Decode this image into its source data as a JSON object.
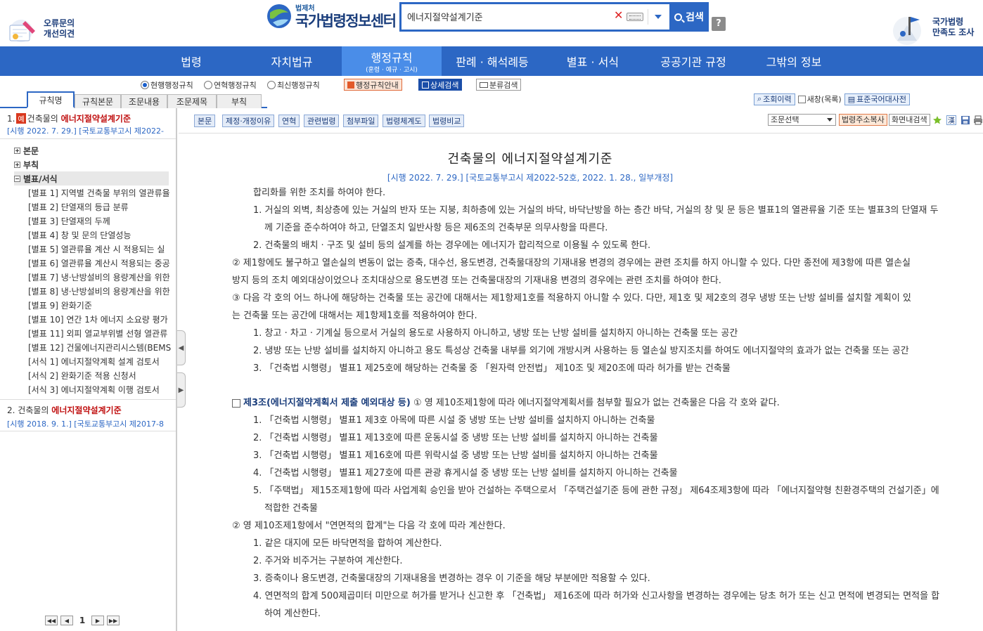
{
  "header": {
    "feedback_line1": "오류문의",
    "feedback_line2": "개선의견",
    "logo_sub": "법제처",
    "logo_main": "국가법령정보센터",
    "search_value": "에너지절약설계기준",
    "search_button": "검색",
    "help_label": "?",
    "survey_line1": "국가법령",
    "survey_line2": "만족도 조사"
  },
  "nav": {
    "items": [
      {
        "label": "법령",
        "sub": ""
      },
      {
        "label": "자치법규",
        "sub": ""
      },
      {
        "label": "행정규칙",
        "sub": "(훈령 · 예규 · 고시)"
      },
      {
        "label": "판례 · 해석례등",
        "sub": ""
      },
      {
        "label": "별표 · 서식",
        "sub": ""
      },
      {
        "label": "공공기관 규정",
        "sub": ""
      },
      {
        "label": "그밖의 정보",
        "sub": ""
      }
    ],
    "active_index": 2
  },
  "options": {
    "radios": [
      "현행행정규칙",
      "연혁행정규칙",
      "최신행정규칙"
    ],
    "selected_radio": 0,
    "btn_guide": "행정규칙안내",
    "btn_detail": "상세검색",
    "btn_class": "분류검색"
  },
  "left_tabs": [
    "규칙명",
    "규칙본문",
    "조문내용",
    "조문제목",
    "부칙"
  ],
  "right_tools": {
    "history": "조회이력",
    "newwin": "새창(목록)",
    "dictionary": "표준국어대사전"
  },
  "results": [
    {
      "index": "1.",
      "badge": "예",
      "prefix": "건축물의",
      "highlight": "에너지절약설계기준",
      "sub": "[시행 2022. 7. 29.] [국토교통부고시 제2022-"
    },
    {
      "index": "2.",
      "prefix": "건축물의",
      "highlight": "에너지절약설계기준",
      "sub": "[시행 2018. 9. 1.] [국토교통부고시 제2017-8"
    }
  ],
  "tree": {
    "nodes": [
      "본문",
      "부칙",
      "별표/서식"
    ],
    "leaves": [
      "[별표 1] 지역별 건축물 부위의 열관류율",
      "[별표 2] 단열재의 등급 분류",
      "[별표 3] 단열재의 두께",
      "[별표 4] 창 및 문의 단열성능",
      "[별표 5] 열관류율 계산 시 적용되는 실",
      "[별표 6] 열관류율 계산시 적용되는 중공",
      "[별표 7] 냉·난방설비의 용량계산을 위한",
      "[별표 8] 냉·난방설비의 용량계산을 위한",
      "[별표 9] 완화기준",
      "[별표 10] 연간 1차 에너지 소요량 평가",
      "[별표 11] 외피 열교부위별 선형 열관류",
      "[별표 12] 건물에너지관리시스템(BEMS",
      "[서식 1] 에너지절약계획 설계 검토서",
      "[서식 2] 완화기준 적용 신청서",
      "[서식 3] 에너지절약계획 이행 검토서"
    ]
  },
  "pager": {
    "current": "1"
  },
  "toolbar": {
    "buttons": [
      "본문",
      "제정·개정이유",
      "연혁",
      "관련법령",
      "첨부파일",
      "법령체계도",
      "법령비교"
    ],
    "select_article": "조문선택",
    "copy_address": "법령주소복사",
    "find_in_page": "화면내검색"
  },
  "document": {
    "title": "건축물의 에너지절약설계기준",
    "subtitle": "[시행 2022. 7. 29.] [국토교통부고시 제2022-52호, 2022. 1. 28., 일부개정]",
    "lines": [
      "합리화를 위한 조치를 하여야 한다.",
      "1. 거실의 외벽, 최상층에 있는 거실의 반자 또는 지붕, 최하층에 있는 거실의 바닥, 바닥난방을 하는 층간 바닥, 거실의 창 및 문 등은 별표1의 열관류율 기준 또는 별표3의 단열재 두",
      "께 기준을 준수하여야 하고, 단열조치 일반사항 등은 제6조의 건축부문 의무사항을 따른다.",
      "2. 건축물의 배치 · 구조 및 설비 등의 설계를 하는 경우에는 에너지가 합리적으로 이용될 수 있도록 한다.",
      "② 제1항에도 불구하고 열손실의 변동이 없는 증축, 대수선, 용도변경, 건축물대장의 기재내용 변경의 경우에는 관련 조치를 하지 아니할 수 있다. 다만 종전에 제3항에 따른 열손실",
      "방지 등의 조치 예외대상이었으나 조치대상으로 용도변경 또는 건축물대장의 기재내용 변경의 경우에는 관련 조치를 하여야 한다.",
      "③ 다음 각 호의 어느 하나에 해당하는 건축물 또는 공간에 대해서는 제1항제1호를 적용하지 아니할 수 있다. 다만, 제1호 및 제2호의 경우 냉방 또는 난방 설비를 설치할 계획이 있",
      "는 건축물 또는 공간에 대해서는 제1항제1호를 적용하여야 한다.",
      "1. 창고 · 차고 · 기계실 등으로서 거실의 용도로 사용하지 아니하고, 냉방 또는 난방 설비를 설치하지 아니하는 건축물 또는 공간",
      "2. 냉방 또는 난방 설비를 설치하지 아니하고 용도 특성상 건축물 내부를 외기에 개방시켜 사용하는 등 열손실 방지조치를 하여도 에너지절약의 효과가 없는 건축물 또는 공간",
      "3. 「건축법 시행령」 별표1 제25호에 해당하는 건축물 중 「원자력 안전법」 제10조 및 제20조에 따라 허가를 받는 건축물"
    ],
    "article_title": "제3조(에너지절약계획서 제출 예외대상 등)",
    "article_intro": " ① 영 제10조제1항에 따라 에너지절약계획서를 첨부할 필요가 없는 건축물은 다음 각 호와 같다.",
    "article_lines": [
      "1. 「건축법 시행령」 별표1 제3호 아목에 따른 시설 중 냉방 또는 난방 설비를 설치하지 아니하는 건축물",
      "2. 「건축법 시행령」 별표1 제13호에 따른 운동시설 중 냉방 또는 난방 설비를 설치하지 아니하는 건축물",
      "3. 「건축법 시행령」 별표1 제16호에 따른 위락시설 중 냉방 또는 난방 설비를 설치하지 아니하는 건축물",
      "4. 「건축법 시행령」 별표1 제27호에 따른 관광 휴게시설 중 냉방 또는 난방 설비를 설치하지 아니하는 건축물",
      "5. 「주택법」 제15조제1항에 따라 사업계획 승인을 받아 건설하는 주택으로서 「주택건설기준 등에 관한 규정」 제64조제3항에 따라 「에너지절약형 친환경주택의 건설기준」에",
      "적합한 건축물",
      "② 영 제10조제1항에서 \"연면적의 합계\"는 다음 각 호에 따라 계산한다.",
      "1. 같은 대지에 모든 바닥면적을 합하여 계산한다.",
      "2. 주거와 비주거는 구분하여 계산한다.",
      "3. 증축이나 용도변경, 건축물대장의 기재내용을 변경하는 경우 이 기준을 해당 부분에만 적용할 수 있다.",
      "4. 연면적의 합계 500제곱미터 미만으로 허가를 받거나 신고한 후 「건축법」 제16조에 따라 허가와 신고사항을 변경하는 경우에는 당초 허가 또는 신고 면적에 변경되는 면적을 합",
      "하여 계산한다."
    ]
  }
}
